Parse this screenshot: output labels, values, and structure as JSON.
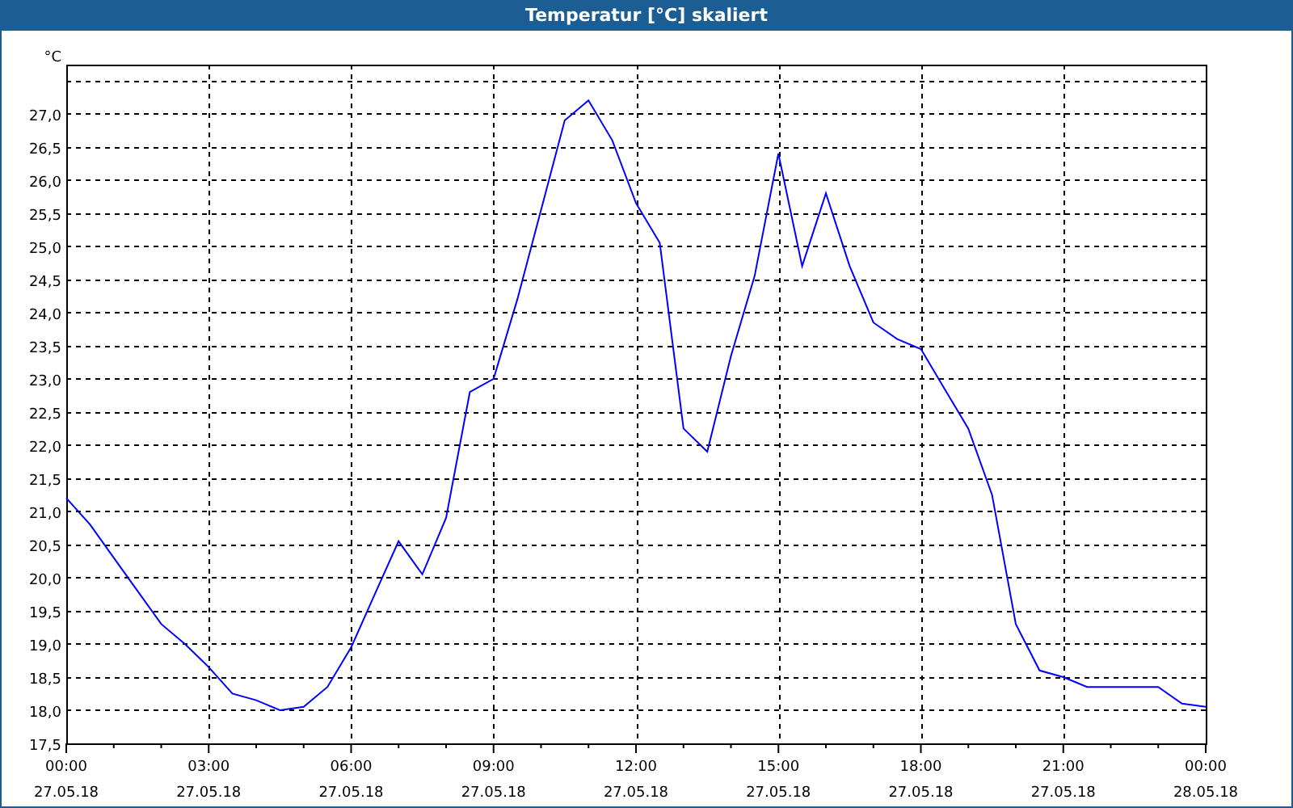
{
  "window": {
    "title": "Temperatur [°C] skaliert"
  },
  "chart": {
    "x_dates": [
      "27.05.18",
      "27.05.18",
      "27.05.18",
      "27.05.18",
      "27.05.18",
      "27.05.18",
      "27.05.18",
      "27.05.18",
      "28.05.18"
    ],
    "chart_data": {
      "type": "line",
      "ylabel": "°C",
      "grid": true,
      "xlim": [
        0,
        24
      ],
      "ylim": [
        17.5,
        27.74
      ],
      "x": [
        0,
        0.5,
        1,
        1.5,
        2,
        2.5,
        3,
        3.5,
        4,
        4.5,
        5,
        5.5,
        6,
        6.5,
        7,
        7.5,
        8,
        8.5,
        9,
        9.5,
        10,
        10.5,
        11,
        11.5,
        12,
        12.5,
        13,
        13.5,
        14,
        14.5,
        15,
        15.5,
        16,
        16.5,
        17,
        17.5,
        18,
        18.5,
        19,
        19.5,
        20,
        20.5,
        21,
        21.5,
        22,
        22.5,
        23,
        23.5,
        24
      ],
      "series": [
        {
          "color": "#0000ff",
          "values": [
            21.2,
            20.8,
            20.3,
            19.8,
            19.3,
            19.0,
            18.65,
            18.25,
            18.15,
            18.0,
            18.05,
            18.35,
            18.95,
            19.75,
            20.55,
            20.05,
            20.9,
            22.8,
            23.0,
            24.2,
            25.55,
            26.9,
            27.2,
            26.6,
            25.65,
            25.05,
            22.25,
            21.9,
            23.35,
            24.55,
            26.4,
            24.7,
            25.8,
            24.7,
            23.85,
            23.6,
            23.45,
            22.85,
            22.25,
            21.25,
            19.3,
            18.6,
            18.5,
            18.35,
            18.35,
            18.35,
            18.35,
            18.1,
            18.05
          ]
        }
      ],
      "xticks": [
        {
          "value": 0,
          "label": "00:00"
        },
        {
          "value": 3,
          "label": "03:00"
        },
        {
          "value": 6,
          "label": "06:00"
        },
        {
          "value": 9,
          "label": "09:00"
        },
        {
          "value": 12,
          "label": "12:00"
        },
        {
          "value": 15,
          "label": "15:00"
        },
        {
          "value": 18,
          "label": "18:00"
        },
        {
          "value": 21,
          "label": "21:00"
        },
        {
          "value": 24,
          "label": "00:00"
        }
      ],
      "yticks": [
        {
          "value": 17.5,
          "label": "17,5"
        },
        {
          "value": 18,
          "label": "18,0"
        },
        {
          "value": 18.5,
          "label": "18,5"
        },
        {
          "value": 19,
          "label": "19,0"
        },
        {
          "value": 19.5,
          "label": "19,5"
        },
        {
          "value": 20,
          "label": "20,0"
        },
        {
          "value": 20.5,
          "label": "20,5"
        },
        {
          "value": 21,
          "label": "21,0"
        },
        {
          "value": 21.5,
          "label": "21,5"
        },
        {
          "value": 22,
          "label": "22,0"
        },
        {
          "value": 22.5,
          "label": "22,5"
        },
        {
          "value": 23,
          "label": "23,0"
        },
        {
          "value": 23.5,
          "label": "23,5"
        },
        {
          "value": 24,
          "label": "24,0"
        },
        {
          "value": 24.5,
          "label": "24,5"
        },
        {
          "value": 25,
          "label": "25,0"
        },
        {
          "value": 25.5,
          "label": "25,5"
        },
        {
          "value": 26,
          "label": "26,0"
        },
        {
          "value": 26.5,
          "label": "26,5"
        },
        {
          "value": 27,
          "label": "27,0"
        }
      ]
    }
  }
}
